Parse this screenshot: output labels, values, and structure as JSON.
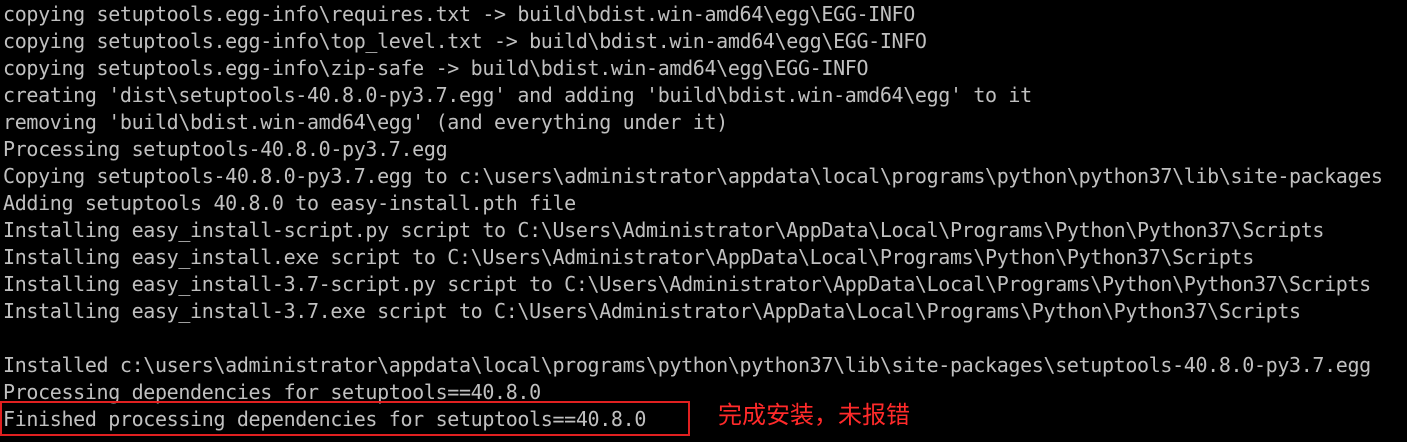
{
  "console": {
    "lines": [
      "copying setuptools.egg-info\\requires.txt -> build\\bdist.win-amd64\\egg\\EGG-INFO",
      "copying setuptools.egg-info\\top_level.txt -> build\\bdist.win-amd64\\egg\\EGG-INFO",
      "copying setuptools.egg-info\\zip-safe -> build\\bdist.win-amd64\\egg\\EGG-INFO",
      "creating 'dist\\setuptools-40.8.0-py3.7.egg' and adding 'build\\bdist.win-amd64\\egg' to it",
      "removing 'build\\bdist.win-amd64\\egg' (and everything under it)",
      "Processing setuptools-40.8.0-py3.7.egg",
      "Copying setuptools-40.8.0-py3.7.egg to c:\\users\\administrator\\appdata\\local\\programs\\python\\python37\\lib\\site-packages",
      "Adding setuptools 40.8.0 to easy-install.pth file",
      "Installing easy_install-script.py script to C:\\Users\\Administrator\\AppData\\Local\\Programs\\Python\\Python37\\Scripts",
      "Installing easy_install.exe script to C:\\Users\\Administrator\\AppData\\Local\\Programs\\Python\\Python37\\Scripts",
      "Installing easy_install-3.7-script.py script to C:\\Users\\Administrator\\AppData\\Local\\Programs\\Python\\Python37\\Scripts",
      "Installing easy_install-3.7.exe script to C:\\Users\\Administrator\\AppData\\Local\\Programs\\Python\\Python37\\Scripts",
      "",
      "Installed c:\\users\\administrator\\appdata\\local\\programs\\python\\python37\\lib\\site-packages\\setuptools-40.8.0-py3.7.egg",
      "Processing dependencies for setuptools==40.8.0",
      "Finished processing dependencies for setuptools==40.8.0"
    ]
  },
  "annotation": {
    "text": "完成安装，未报错"
  },
  "colors": {
    "background": "#000000",
    "text": "#c0c0c0",
    "highlight": "#e02020",
    "annotation": "#ff2a2a"
  }
}
